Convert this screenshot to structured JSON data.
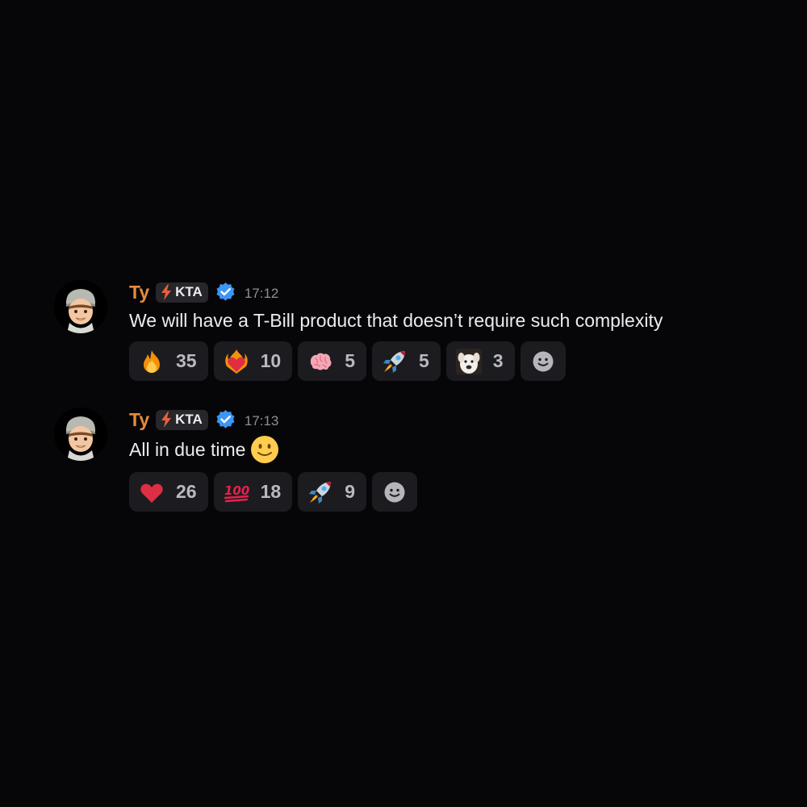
{
  "colors": {
    "background": "#060608",
    "username": "#e88a3b",
    "verified": "#3d95f5",
    "reaction_bg": "#1c1c20"
  },
  "messages": [
    {
      "username": "Ty",
      "tag": "KTA",
      "tag_icon": "lightning-icon",
      "verified_icon": "verified-badge-icon",
      "time": "17:12",
      "text": "We will have a T-Bill product that doesn’t require such complexity",
      "reactions": [
        {
          "icon": "fire-icon",
          "count": "35"
        },
        {
          "icon": "flaming-heart-icon",
          "count": "10"
        },
        {
          "icon": "brain-icon",
          "count": "5"
        },
        {
          "icon": "rocket-icon",
          "count": "5"
        },
        {
          "icon": "dog-face-icon",
          "count": "3"
        }
      ],
      "add_reaction_icon": "add-reaction-smiley-icon"
    },
    {
      "username": "Ty",
      "tag": "KTA",
      "tag_icon": "lightning-icon",
      "verified_icon": "verified-badge-icon",
      "time": "17:13",
      "text": "All in due time",
      "text_emoji": "slightly-smiling-face-icon",
      "reactions": [
        {
          "icon": "red-heart-icon",
          "count": "26"
        },
        {
          "icon": "hundred-points-icon",
          "count": "18"
        },
        {
          "icon": "rocket-icon",
          "count": "9"
        }
      ],
      "add_reaction_icon": "add-reaction-smiley-icon"
    }
  ]
}
